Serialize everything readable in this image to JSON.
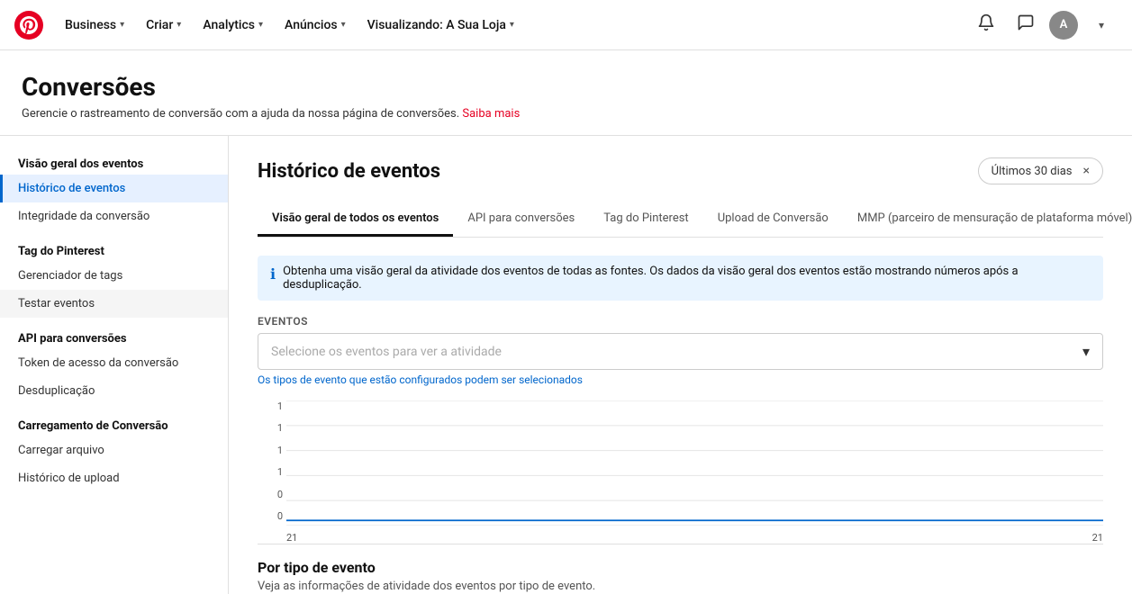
{
  "nav": {
    "logo_alt": "Pinterest",
    "items": [
      {
        "label": "Business",
        "has_chevron": true
      },
      {
        "label": "Criar",
        "has_chevron": true
      },
      {
        "label": "Analytics",
        "has_chevron": true
      },
      {
        "label": "Anúncios",
        "has_chevron": true
      },
      {
        "label": "Visualizando: A Sua Loja",
        "has_chevron": true
      }
    ],
    "notification_icon": "🔔",
    "chat_icon": "💬",
    "avatar_label": "A",
    "chevron_icon": "▾"
  },
  "page": {
    "title": "Conversões",
    "subtitle": "Gerencie o rastreamento de conversão com a ajuda da nossa página de conversões.",
    "subtitle_link": "Saiba mais"
  },
  "sidebar": {
    "sections": [
      {
        "title": "Visão geral dos eventos",
        "items": [
          {
            "label": "Histórico de eventos",
            "active": true
          },
          {
            "label": "Integridade da conversão",
            "active": false
          }
        ]
      },
      {
        "title": "Tag do Pinterest",
        "items": [
          {
            "label": "Gerenciador de tags",
            "active": false
          },
          {
            "label": "Testar eventos",
            "active": false,
            "hovered": true
          }
        ]
      },
      {
        "title": "API para conversões",
        "items": [
          {
            "label": "Token de acesso da conversão",
            "active": false
          },
          {
            "label": "Desduplicação",
            "active": false
          }
        ]
      },
      {
        "title": "Carregamento de Conversão",
        "items": [
          {
            "label": "Carregar arquivo",
            "active": false
          },
          {
            "label": "Histórico de upload",
            "active": false
          }
        ]
      }
    ]
  },
  "content": {
    "title": "Histórico de eventos",
    "date_filter": "Últimos 30 dias",
    "close_icon": "×",
    "tabs": [
      {
        "label": "Visão geral de todos os eventos",
        "active": true
      },
      {
        "label": "API para conversões",
        "active": false
      },
      {
        "label": "Tag do Pinterest",
        "active": false
      },
      {
        "label": "Upload de Conversão",
        "active": false
      },
      {
        "label": "MMP (parceiro de mensuração de plataforma móvel)",
        "active": false
      }
    ],
    "info_text": "Obtenha uma visão geral da atividade dos eventos de todas as fontes. Os dados da visão geral dos eventos estão mostrando números após a desduplicação.",
    "events_label": "Eventos",
    "events_placeholder": "Selecione os eventos para ver a atividade",
    "events_hint": "Os tipos de evento que estão configurados podem ser selecionados",
    "chart": {
      "y_labels": [
        "1",
        "1",
        "1",
        "1",
        "0",
        "0"
      ],
      "x_labels": [
        "21",
        "21"
      ]
    },
    "section_title": "Por tipo de evento",
    "section_subtitle": "Veja as informações de atividade dos eventos por tipo de evento."
  }
}
